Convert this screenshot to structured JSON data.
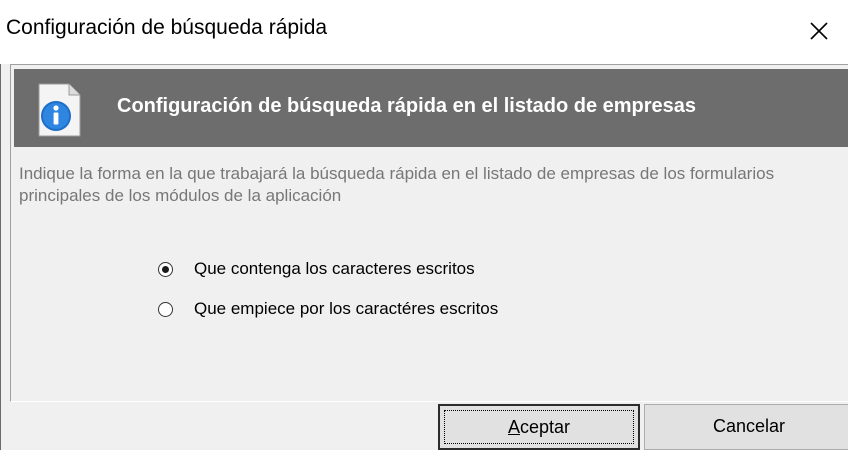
{
  "window": {
    "title": "Configuración de búsqueda rápida"
  },
  "banner": {
    "icon": "info-icon",
    "title": "Configuración de búsqueda rápida en el listado de empresas"
  },
  "description": "Indique la forma en la que trabajará la búsqueda rápida en el listado de empresas de los formularios principales de los módulos de la aplicación",
  "options": [
    {
      "label": "Que contenga los caracteres escritos",
      "selected": true
    },
    {
      "label": "Que empiece por los caractéres escritos",
      "selected": false
    }
  ],
  "buttons": {
    "accept_mnemonic": "A",
    "accept_rest": "ceptar",
    "cancel": "Cancelar"
  },
  "colors": {
    "banner_bg": "#6d6d6d",
    "window_bg": "#f0f0f0",
    "description_text": "#777777"
  }
}
